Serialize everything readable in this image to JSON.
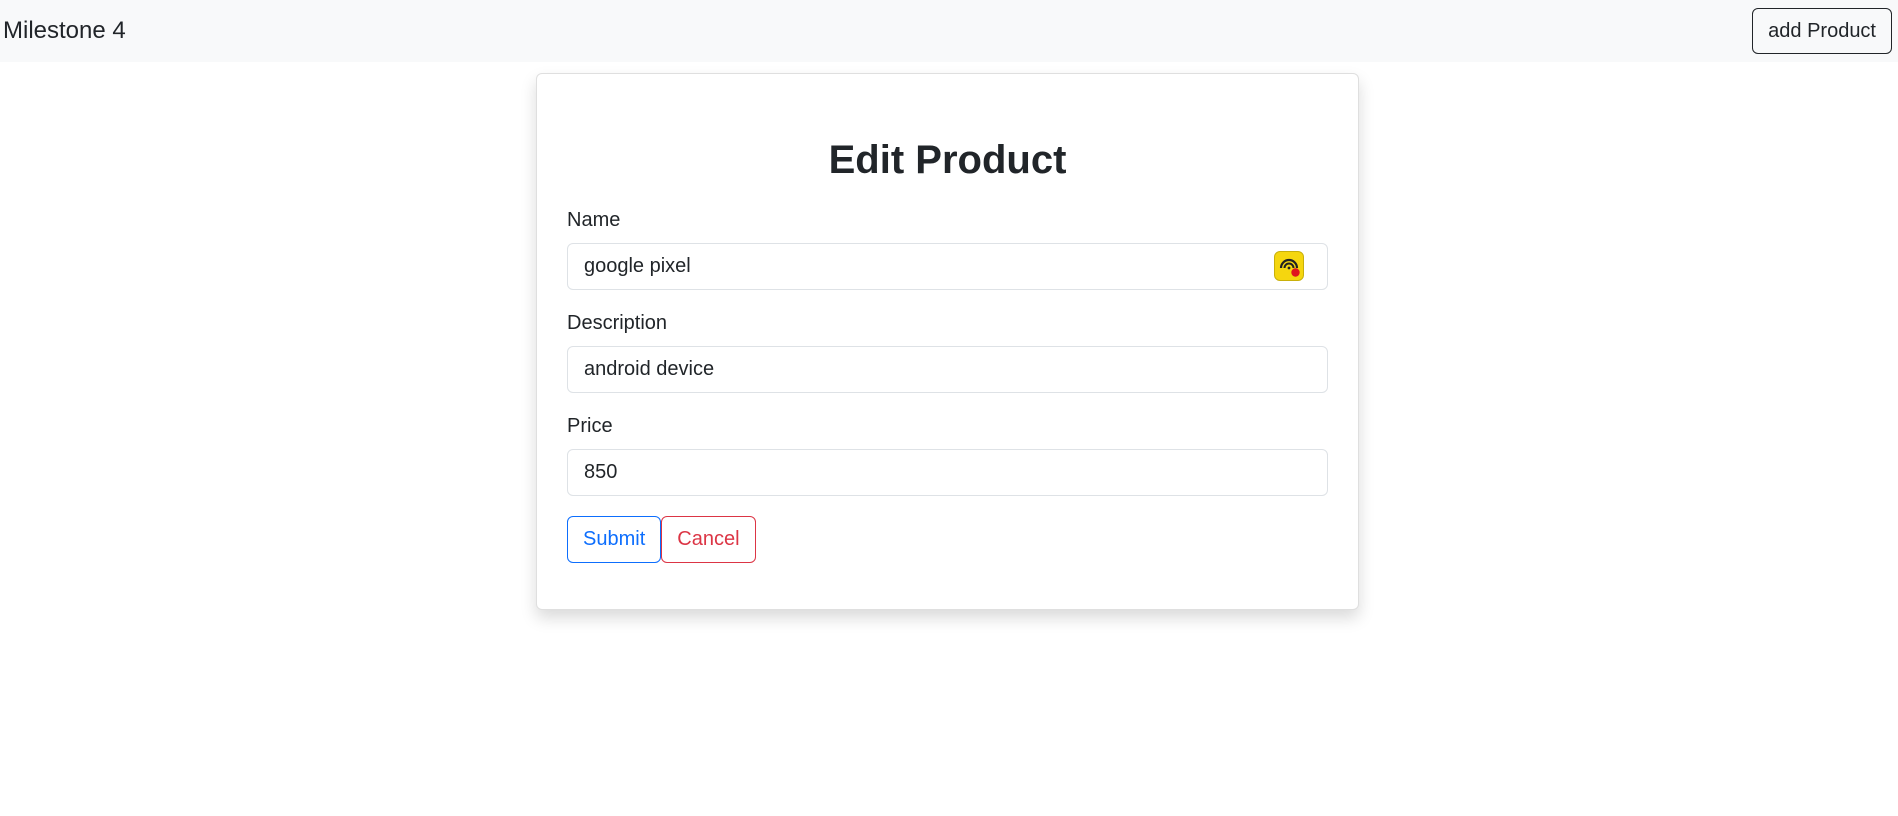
{
  "navbar": {
    "brand": "Milestone 4",
    "add_button": "add Product"
  },
  "form": {
    "title": "Edit Product",
    "fields": [
      {
        "label": "Name",
        "value": "google pixel"
      },
      {
        "label": "Description",
        "value": "android device"
      },
      {
        "label": "Price",
        "value": "850"
      }
    ],
    "submit_label": "Submit",
    "cancel_label": "Cancel"
  },
  "icons": {
    "name_field_extension": "password-manager-extension-icon"
  },
  "colors": {
    "primary": "#0d6efd",
    "danger": "#dc3545",
    "navbar_bg": "#f8f9fa",
    "extension_icon": "#f5d60f"
  }
}
